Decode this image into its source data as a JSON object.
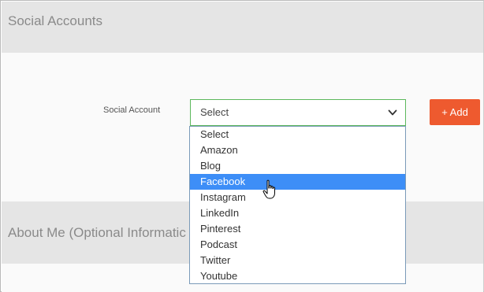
{
  "sections": {
    "social_title": "Social Accounts",
    "about_title": "About Me (Optional Informatic"
  },
  "social_form": {
    "label": "Social Account",
    "select_value": "Select",
    "add_label": "+ Add"
  },
  "dropdown": {
    "options": [
      "Select",
      "Amazon",
      "Blog",
      "Facebook",
      "Instagram",
      "LinkedIn",
      "Pinterest",
      "Podcast",
      "Twitter",
      "Youtube"
    ],
    "highlighted": "Facebook"
  },
  "colors": {
    "accent": "#ee5a2f",
    "highlight": "#3d8ef7",
    "select_border": "#5cb85c"
  },
  "icons": {
    "chevron": "chevron-down-icon",
    "cursor": "hand-pointer-icon"
  }
}
